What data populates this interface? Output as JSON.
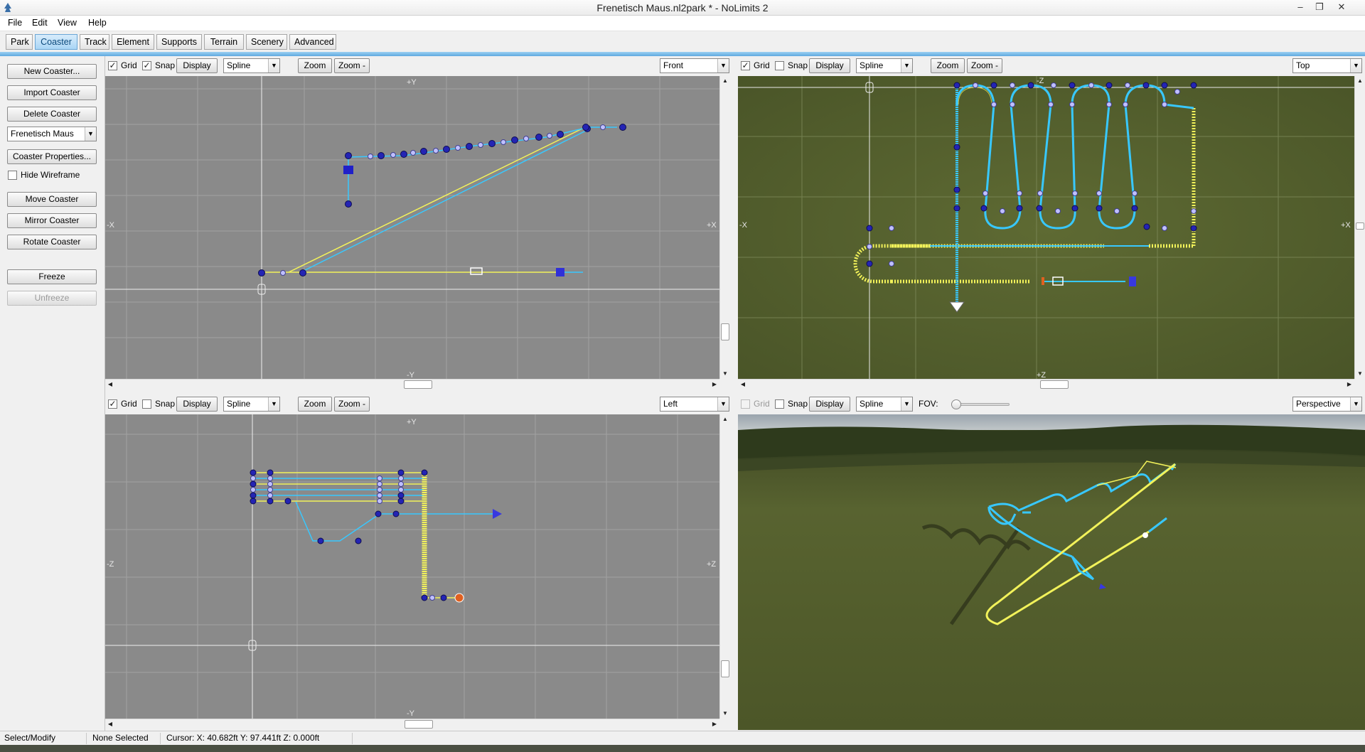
{
  "window": {
    "title": "Frenetisch Maus.nl2park * - NoLimits 2",
    "minimize": "–",
    "restore": "❐",
    "close": "✕"
  },
  "menu": [
    "File",
    "Edit",
    "View",
    "Help"
  ],
  "tabs": [
    "Park",
    "Coaster",
    "Track",
    "Element",
    "Supports",
    "Terrain",
    "Scenery",
    "Advanced"
  ],
  "active_tab": "Coaster",
  "left_panel": {
    "new_coaster": "New Coaster...",
    "import_coaster": "Import Coaster",
    "delete_coaster": "Delete Coaster",
    "coaster_select": "Frenetisch Maus",
    "coaster_properties": "Coaster Properties...",
    "hide_wireframe": "Hide Wireframe",
    "move_coaster": "Move Coaster",
    "mirror_coaster": "Mirror Coaster",
    "rotate_coaster": "Rotate Coaster",
    "freeze": "Freeze",
    "unfreeze": "Unfreeze"
  },
  "viewport_toolbar": {
    "grid": "Grid",
    "snap": "Snap",
    "display": "Display",
    "mode": "Spline",
    "zoom_in": "Zoom +",
    "zoom_out": "Zoom -",
    "fov": "FOV:",
    "check_mark": "✓"
  },
  "viewports": {
    "front": {
      "view": "Front",
      "grid_checked": true,
      "snap_checked": true,
      "axis_top": "+Y",
      "axis_bottom": "-Y",
      "axis_left": "-X",
      "axis_right": "+X"
    },
    "top": {
      "view": "Top",
      "grid_checked": true,
      "snap_checked": false,
      "axis_top": "-Z",
      "axis_bottom": "+Z",
      "axis_left": "-X",
      "axis_right": "+X"
    },
    "left": {
      "view": "Left",
      "grid_checked": true,
      "snap_checked": false,
      "axis_top": "+Y",
      "axis_bottom": "-Y",
      "axis_left": "-Z",
      "axis_right": "+Z"
    },
    "perspective": {
      "view": "Perspective",
      "grid_checked": false,
      "snap_checked": false
    }
  },
  "status": {
    "mode": "Select/Modify",
    "selection": "None Selected",
    "cursor": "Cursor: X: 40.682ft Y: 97.441ft Z: 0.000ft"
  },
  "colors": {
    "accent": "#5fa9df",
    "viewport_bg": "#8a8a8a",
    "rail_yellow": "#f2f25a",
    "rail_cyan": "#38c8ff",
    "node_blue": "#2424b4",
    "terrain": "#56622e"
  }
}
